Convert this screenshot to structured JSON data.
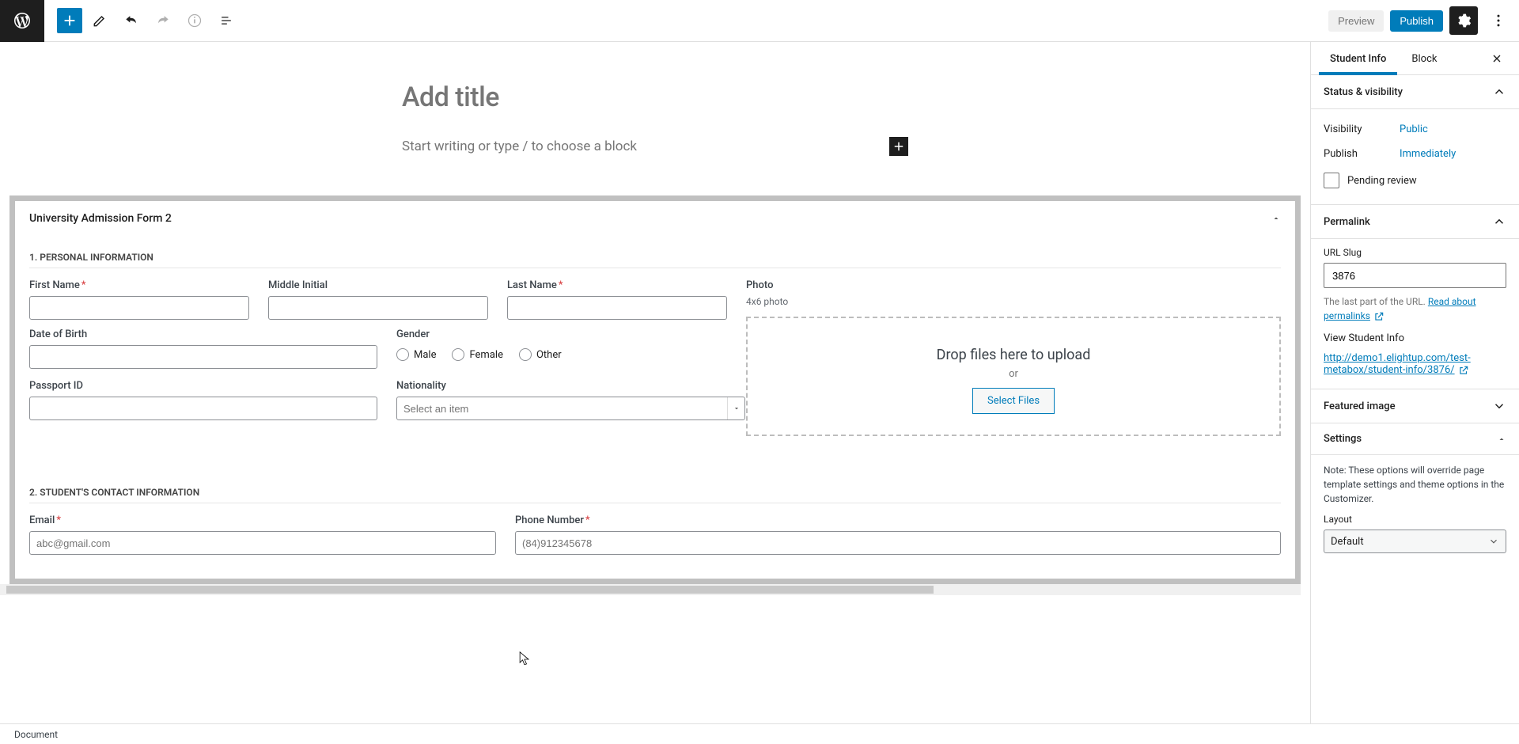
{
  "header": {
    "preview_label": "Preview",
    "publish_label": "Publish"
  },
  "editor": {
    "title_placeholder": "Add title",
    "content_prompt": "Start writing or type / to choose a block",
    "metabox": {
      "title": "University Admission Form 2",
      "section1": {
        "heading": "1. PERSONAL INFORMATION",
        "first_name_label": "First Name",
        "middle_initial_label": "Middle Initial",
        "last_name_label": "Last Name",
        "photo_label": "Photo",
        "photo_hint": "4x6 photo",
        "dob_label": "Date of Birth",
        "gender_label": "Gender",
        "gender_options": {
          "male": "Male",
          "female": "Female",
          "other": "Other"
        },
        "passport_label": "Passport ID",
        "nationality_label": "Nationality",
        "nationality_placeholder": "Select an item",
        "drop_text": "Drop files here to upload",
        "drop_or": "or",
        "select_files": "Select Files"
      },
      "section2": {
        "heading": "2. STUDENT'S CONTACT INFORMATION",
        "email_label": "Email",
        "email_placeholder": "abc@gmail.com",
        "phone_label": "Phone Number",
        "phone_placeholder": "(84)912345678"
      }
    }
  },
  "sidebar": {
    "tabs": {
      "doc": "Student Info",
      "block": "Block"
    },
    "status_visibility": {
      "title": "Status & visibility",
      "visibility_label": "Visibility",
      "visibility_value": "Public",
      "publish_label": "Publish",
      "publish_value": "Immediately",
      "pending_review": "Pending review"
    },
    "permalink": {
      "title": "Permalink",
      "slug_label": "URL Slug",
      "slug_value": "3876",
      "help_prefix": "The last part of the URL. ",
      "help_link": "Read about permalinks",
      "view_label": "View Student Info",
      "url": "http://demo1.elightup.com/test-metabox/student-info/3876/"
    },
    "featured_image": {
      "title": "Featured image"
    },
    "settings": {
      "title": "Settings",
      "note": "Note: These options will override page template settings and theme options in the Customizer.",
      "layout_label": "Layout",
      "layout_value": "Default"
    }
  },
  "statusbar": {
    "label": "Document"
  }
}
